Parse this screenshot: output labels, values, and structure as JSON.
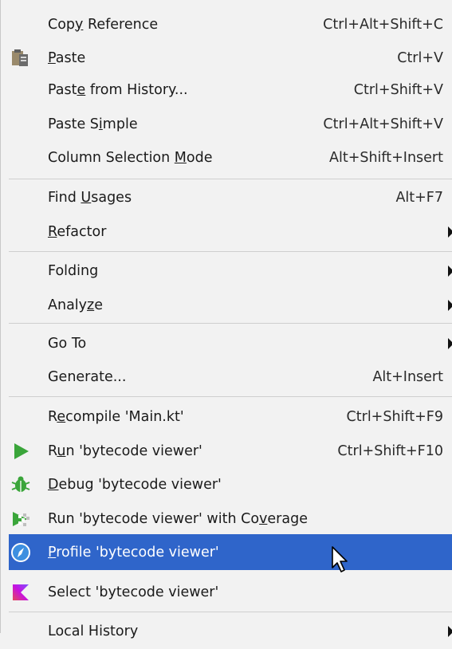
{
  "menu": {
    "items": [
      {
        "pre": "Cop",
        "u": "y",
        "post": " Reference",
        "shortcut": "Ctrl+Alt+Shift+C"
      },
      {
        "pre": "",
        "u": "P",
        "post": "aste",
        "shortcut": "Ctrl+V",
        "icon": "paste-icon"
      },
      {
        "pre": "Past",
        "u": "e",
        "post": " from History...",
        "shortcut": "Ctrl+Shift+V"
      },
      {
        "pre": "Paste S",
        "u": "i",
        "post": "mple",
        "shortcut": "Ctrl+Alt+Shift+V"
      },
      {
        "pre": "Column Selection ",
        "u": "M",
        "post": "ode",
        "shortcut": "Alt+Shift+Insert"
      },
      {
        "pre": "Find ",
        "u": "U",
        "post": "sages",
        "shortcut": "Alt+F7"
      },
      {
        "pre": "",
        "u": "R",
        "post": "efactor",
        "submenu": true
      },
      {
        "pre": "Folding",
        "u": "",
        "post": "",
        "submenu": true
      },
      {
        "pre": "Analy",
        "u": "z",
        "post": "e",
        "submenu": true
      },
      {
        "pre": "Go To",
        "u": "",
        "post": "",
        "submenu": true
      },
      {
        "pre": "Generate...",
        "u": "",
        "post": "",
        "shortcut": "Alt+Insert"
      },
      {
        "pre": "R",
        "u": "e",
        "post": "compile 'Main.kt'",
        "shortcut": "Ctrl+Shift+F9"
      },
      {
        "pre": "R",
        "u": "u",
        "post": "n 'bytecode viewer'",
        "shortcut": "Ctrl+Shift+F10",
        "icon": "run-icon"
      },
      {
        "pre": "",
        "u": "D",
        "post": "ebug 'bytecode viewer'",
        "icon": "debug-icon"
      },
      {
        "pre": "Run 'bytecode viewer' with Co",
        "u": "v",
        "post": "erage",
        "icon": "coverage-icon"
      },
      {
        "pre": "",
        "u": "P",
        "post": "rofile 'bytecode viewer'",
        "icon": "profile-icon",
        "selected": true
      },
      {
        "pre": "Select 'bytecode viewer'",
        "u": "",
        "post": "",
        "icon": "kotlin-icon"
      },
      {
        "pre": "Local History",
        "u": "",
        "post": "",
        "submenu": true
      }
    ]
  },
  "colors": {
    "background": "#f2f2f2",
    "selection": "#2f65ca",
    "separator": "#cfcfcf",
    "run_green": "#3aa53a"
  }
}
